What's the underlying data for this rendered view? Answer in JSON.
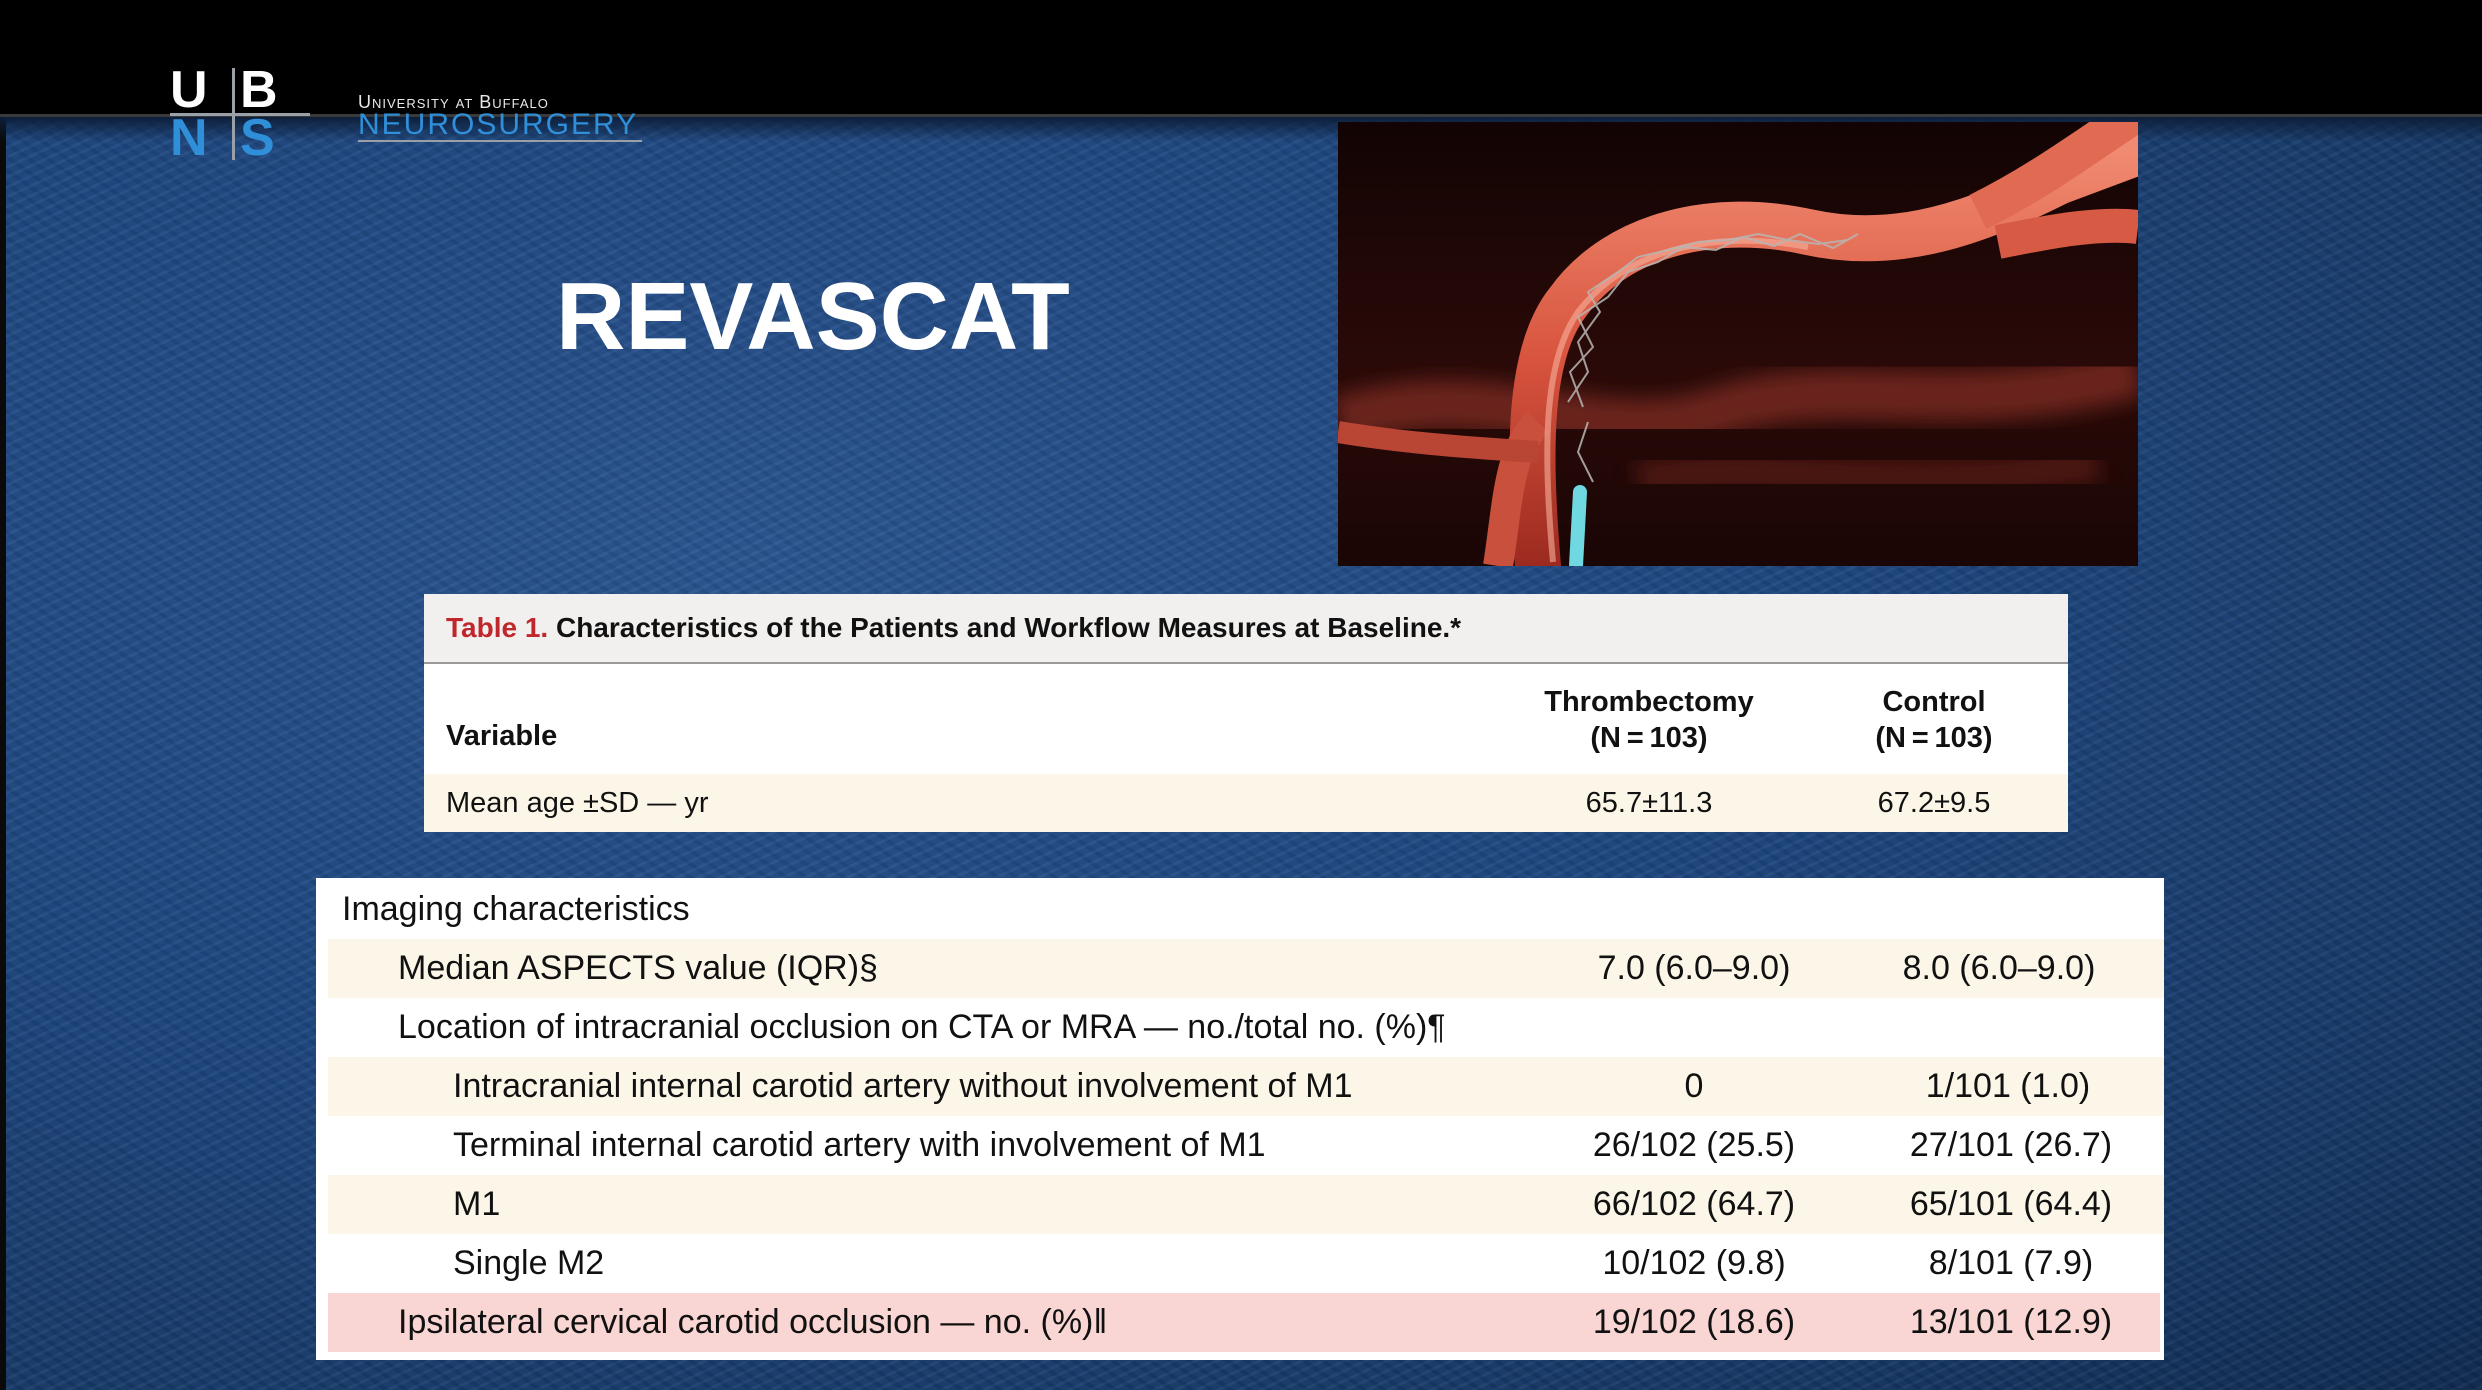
{
  "logo": {
    "letters": [
      "U",
      "B",
      "N",
      "S"
    ],
    "line1": "University at Buffalo",
    "line2": "NEUROSURGERY",
    "colors": {
      "white": "#ffffff",
      "blue": "#2f8fd8"
    }
  },
  "slide": {
    "title": "REVASCAT",
    "background_color": "#1d467f"
  },
  "table1": {
    "caption_label": "Table 1.",
    "caption_text": "Characteristics of the Patients and Workflow Measures at Baseline.*",
    "header": {
      "variable": "Variable",
      "col1_line1": "Thrombectomy",
      "col1_line2": "(N = 103)",
      "col2_line1": "Control",
      "col2_line2": "(N = 103)"
    },
    "rows": [
      {
        "label": "Mean age ±SD — yr",
        "thrombectomy": "65.7±11.3",
        "control": "67.2±9.5"
      }
    ]
  },
  "table2": {
    "rows": [
      {
        "label": "Imaging characteristics",
        "thrombectomy": "",
        "control": ""
      },
      {
        "label": "Median ASPECTS value (IQR)§",
        "thrombectomy": "7.0 (6.0–9.0)",
        "control": "8.0 (6.0–9.0)"
      },
      {
        "label": "Location of intracranial occlusion on CTA or MRA — no./total no. (%)¶",
        "thrombectomy": "",
        "control": ""
      },
      {
        "label": "Intracranial internal carotid artery without involvement of M1",
        "thrombectomy": "0",
        "control": "1/101 (1.0)"
      },
      {
        "label": "Terminal internal carotid artery with involvement of M1",
        "thrombectomy": "26/102 (25.5)",
        "control": "27/101 (26.7)"
      },
      {
        "label": "M1",
        "thrombectomy": "66/102 (64.7)",
        "control": "65/101 (64.4)"
      },
      {
        "label": "Single M2",
        "thrombectomy": "10/102 (9.8)",
        "control": "8/101 (7.9)"
      },
      {
        "label": "Ipsilateral cervical carotid occlusion — no. (%)‖",
        "thrombectomy": "19/102 (18.6)",
        "control": "13/101 (12.9)"
      }
    ],
    "colors": {
      "shade": "#fcf6e8",
      "highlight": "#f9d6d3",
      "caption_red": "#c0272d"
    }
  }
}
